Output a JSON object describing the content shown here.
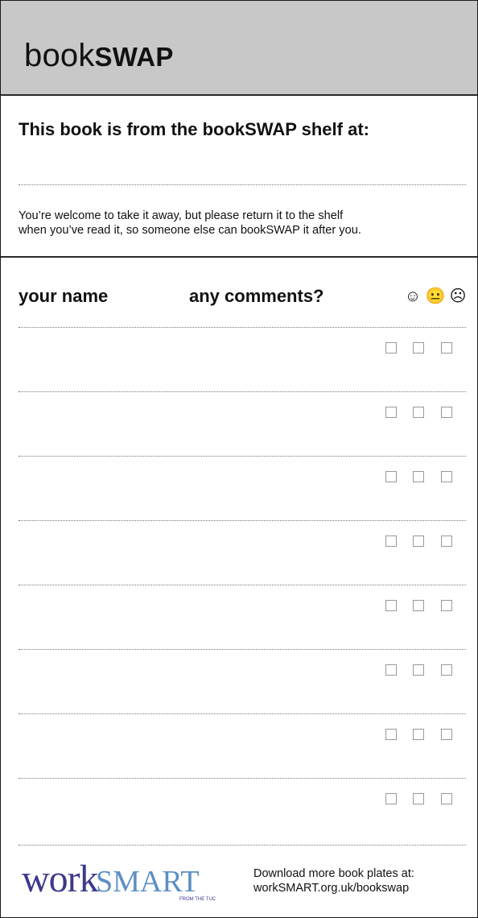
{
  "header": {
    "brand_plain": "book",
    "brand_bold": "SWAP"
  },
  "notice": {
    "from_title": "This book is from the bookSWAP shelf at:",
    "welcome_line1": "You’re welcome to take it away, but please return it to the shelf",
    "welcome_line2": "when you’ve read it, so someone else can bookSWAP it after you."
  },
  "table": {
    "col_name": "your name",
    "col_comments": "any comments?",
    "faces": [
      "☺",
      "😐",
      "☹"
    ],
    "face_names": [
      "happy-face-icon",
      "neutral-face-icon",
      "sad-face-icon"
    ],
    "rows": 8,
    "checkboxes_per_row": 3
  },
  "footer": {
    "logo_text": "workSMART",
    "logo_sub": "FROM THE TUC",
    "download_line1": "Download more book plates at:",
    "download_line2": "workSMART.org.uk/bookswap",
    "logo_colors": {
      "work": "#3c3a8c",
      "smart": "#5d8fc4"
    }
  }
}
